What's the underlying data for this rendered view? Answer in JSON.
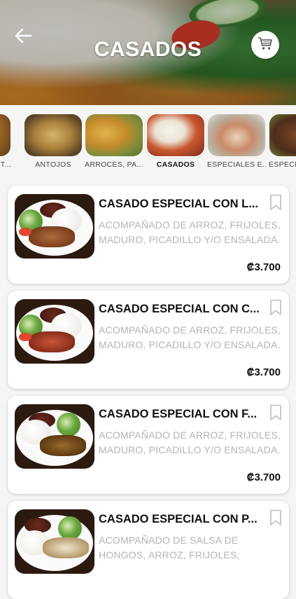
{
  "header": {
    "title": "CASADOS"
  },
  "categories": [
    {
      "label": "T..."
    },
    {
      "label": "ANTOJOS"
    },
    {
      "label": "ARROCES, PA..."
    },
    {
      "label": "CASADOS"
    },
    {
      "label": "ESPECIALES E..."
    },
    {
      "label": "ESPECI..."
    }
  ],
  "active_category": "CASADOS",
  "items": [
    {
      "name": "CASADO ESPECIAL CON L...",
      "description": "ACOMPAÑADO DE ARROZ, FRIJOLES, MADURO, PICADILLO Y/O ENSALADA.",
      "price": "₡3.700"
    },
    {
      "name": "CASADO ESPECIAL CON C...",
      "description": "ACOMPAÑADO DE ARROZ, FRIJOLES, MADURO, PICADILLO Y/O ENSALADA.",
      "price": "₡3.700"
    },
    {
      "name": "CASADO ESPECIAL CON F...",
      "description": "ACOMPAÑADO DE ARROZ, FRIJOLES, MADURO, PICADILLO Y/O ENSALADA.",
      "price": "₡3.700"
    },
    {
      "name": "CASADO ESPECIAL CON P...",
      "description": "ACOMPAÑADO DE SALSA DE HONGOS, ARROZ, FRIJOLES,",
      "price": ""
    }
  ],
  "icons": {
    "back": "arrow-left-icon",
    "cart": "shopping-cart-icon",
    "bookmark": "bookmark-icon"
  },
  "colors": {
    "description_text": "#b4b4b4",
    "card_bg": "#ffffff",
    "page_bg": "#f5f5f5"
  }
}
